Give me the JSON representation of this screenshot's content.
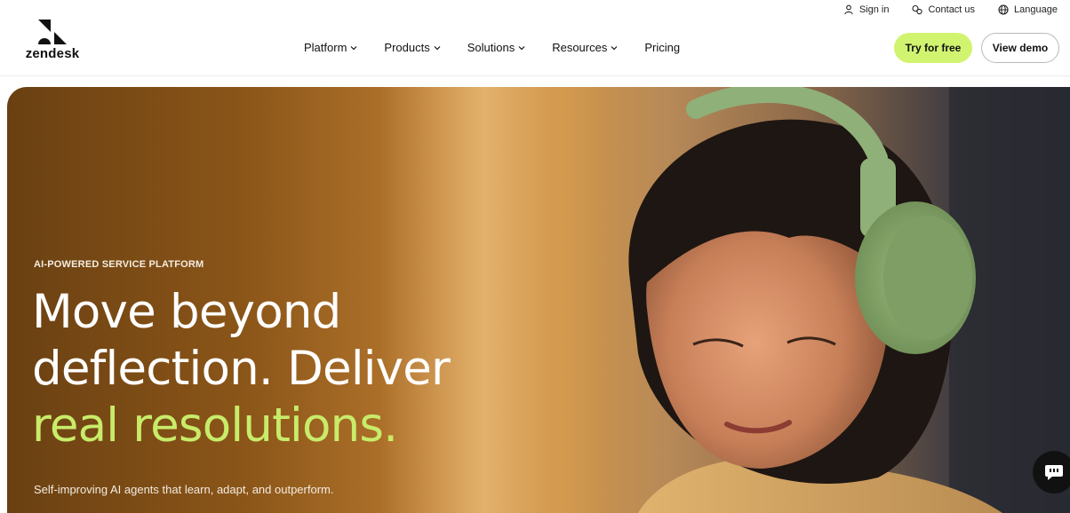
{
  "brand": {
    "name": "zendesk",
    "logo_icon": "zendesk-z-icon"
  },
  "utility_nav": [
    {
      "label": "Sign in",
      "icon": "user-icon"
    },
    {
      "label": "Contact us",
      "icon": "chat-icon"
    },
    {
      "label": "Language",
      "icon": "globe-icon"
    }
  ],
  "main_nav": [
    {
      "label": "Platform",
      "icon": "chevron-down-icon"
    },
    {
      "label": "Products",
      "icon": "chevron-down-icon"
    },
    {
      "label": "Solutions",
      "icon": "chevron-down-icon"
    },
    {
      "label": "Resources",
      "icon": "chevron-down-icon"
    },
    {
      "label": "Pricing"
    }
  ],
  "cta": {
    "primary": "Try for free",
    "secondary": "View demo"
  },
  "hero": {
    "eyebrow": "AI-POWERED SERVICE PLATFORM",
    "headline_line1": "Move beyond",
    "headline_line2": "deflection. Deliver",
    "headline_accent": "real resolutions.",
    "subline": "Self-improving AI agents that learn, adapt, and outperform."
  },
  "colors": {
    "accent_lime": "#d1f470",
    "headline_accent": "#c8ec6a",
    "chat_button": "#111111"
  },
  "chat_widget": {
    "icon": "chat-bubble-icon"
  }
}
